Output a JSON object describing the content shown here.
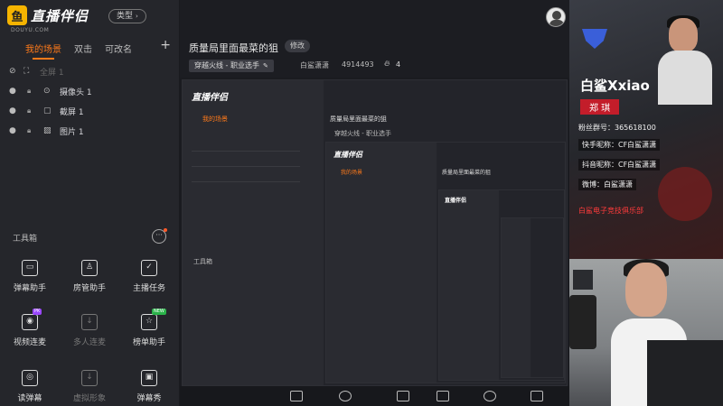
{
  "app": {
    "logo_text": "直播伴侣",
    "logo_sub": "DOUYU.COM",
    "type_label": "类型"
  },
  "scenes": {
    "tabs": [
      "我的场景",
      "双击",
      "可改名"
    ],
    "add_symbol": "+"
  },
  "sources": [
    {
      "name": "全屏 1",
      "kind": "screen",
      "visible": false
    },
    {
      "name": "摄像头 1",
      "kind": "camera",
      "visible": true
    },
    {
      "name": "截屏 1",
      "kind": "crop",
      "visible": true
    },
    {
      "name": "图片 1",
      "kind": "image",
      "visible": true
    }
  ],
  "toolbox": {
    "title": "工具箱",
    "more": "···",
    "tools": [
      {
        "label": "弹幕助手",
        "icon": "danmu-icon",
        "glyph": "▭",
        "disabled": false,
        "badge": ""
      },
      {
        "label": "房管助手",
        "icon": "room-admin-icon",
        "glyph": "♙",
        "disabled": false,
        "badge": ""
      },
      {
        "label": "主播任务",
        "icon": "task-icon",
        "glyph": "✓",
        "disabled": false,
        "badge": ""
      },
      {
        "label": "视频连麦",
        "icon": "video-link-icon",
        "glyph": "◉",
        "disabled": false,
        "badge": "PK"
      },
      {
        "label": "多人连麦",
        "icon": "multi-link-icon",
        "glyph": "↓",
        "disabled": true,
        "badge": ""
      },
      {
        "label": "榜单助手",
        "icon": "rank-icon",
        "glyph": "☆",
        "disabled": false,
        "badge": "NEW"
      },
      {
        "label": "读弹幕",
        "icon": "read-danmu-icon",
        "glyph": "◎",
        "disabled": false,
        "badge": ""
      },
      {
        "label": "虚拟形象",
        "icon": "avatar-icon",
        "glyph": "↓",
        "disabled": true,
        "badge": ""
      },
      {
        "label": "弹幕秀",
        "icon": "danmu-show-icon",
        "glyph": "▣",
        "disabled": false,
        "badge": ""
      }
    ]
  },
  "stream": {
    "title": "质量局里面最菜的狙",
    "edit_label": "修改",
    "category": "穿越火线 - 职业选手",
    "streamer": "白鲨潇潇",
    "room_id": "4914493",
    "hot_count": "4"
  },
  "card": {
    "name_en": "白鲨Xxiao",
    "name_cn": "郑 琪",
    "fan_group": "粉丝群号：365618100",
    "kuaishou": "快手昵称：CF白鲨潇潇",
    "douyin": "抖音昵称：CF白鲨潇潇",
    "weibo": "微博：白鲨潇潇",
    "club": "白鲨电子竞技俱乐部"
  },
  "colors": {
    "accent": "#ff7a1a",
    "panel": "#25262b",
    "club_red": "#ff3b3b"
  }
}
